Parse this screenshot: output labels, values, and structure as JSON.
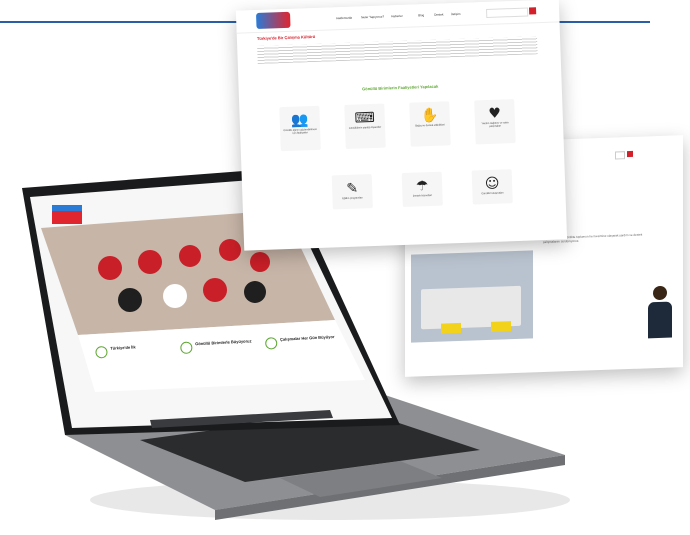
{
  "page": {
    "accent_color": "#2a5fa8",
    "brand_red": "#d4202b",
    "brand_green": "#5fa833"
  },
  "right_panel": {
    "nav": [
      "Hakkımızda",
      "Neler Yapıyoruz?",
      "Haberler",
      "Blog",
      "Destek",
      "İletişim"
    ],
    "headline": "Türkiye'de Bir Çalışma Kültürü",
    "section_title": "Gönüllü Birimlerin Faaliyetleri Yapılacak",
    "cards": [
      {
        "icon": "people-meeting-icon",
        "caption": "Gönüllü ağının güçlendirilmesi için faaliyetler"
      },
      {
        "icon": "desk-work-icon",
        "caption": "Gönüllülerin yaptığı ziyaretler"
      },
      {
        "icon": "handshake-icon",
        "caption": "Bağış ve destek etkinlikleri"
      },
      {
        "icon": "helping-icon",
        "caption": "Yardım dağıtımı ve saha çalışmaları"
      },
      {
        "icon": "education-icon",
        "caption": "Eğitim programları"
      },
      {
        "icon": "support-icon",
        "caption": "Destek hizmetleri"
      },
      {
        "icon": "volunteer-icon",
        "caption": "Gönüllü buluşmaları"
      }
    ]
  },
  "middle_panel": {
    "heading": "İş Modelimiz",
    "paragraph": "Gönüllülerimiz ile birlikte toplumun her kesimine ulaşarak yardım ve destek çalışmalarını sürdürüyoruz."
  },
  "laptop_screen": {
    "nav": [
      "Ana Sayfa",
      "Hakkımızda",
      "Neler Yapıyoruz",
      "Haberler",
      "Blog",
      "İletişim"
    ],
    "features": [
      {
        "icon": "map-icon",
        "title": "Türkiye'de İlk",
        "text": "Gönüllü Birimleri ile Türkiye'nin dört bir yanındayız."
      },
      {
        "icon": "team-icon",
        "title": "Gönüllü Birimlerle Büyüyoruz",
        "text": "Her gün daha fazla gönüllü."
      },
      {
        "icon": "growth-icon",
        "title": "Çalışmalar Her Gün Büyüyor",
        "text": "Aktif projeler."
      }
    ]
  }
}
